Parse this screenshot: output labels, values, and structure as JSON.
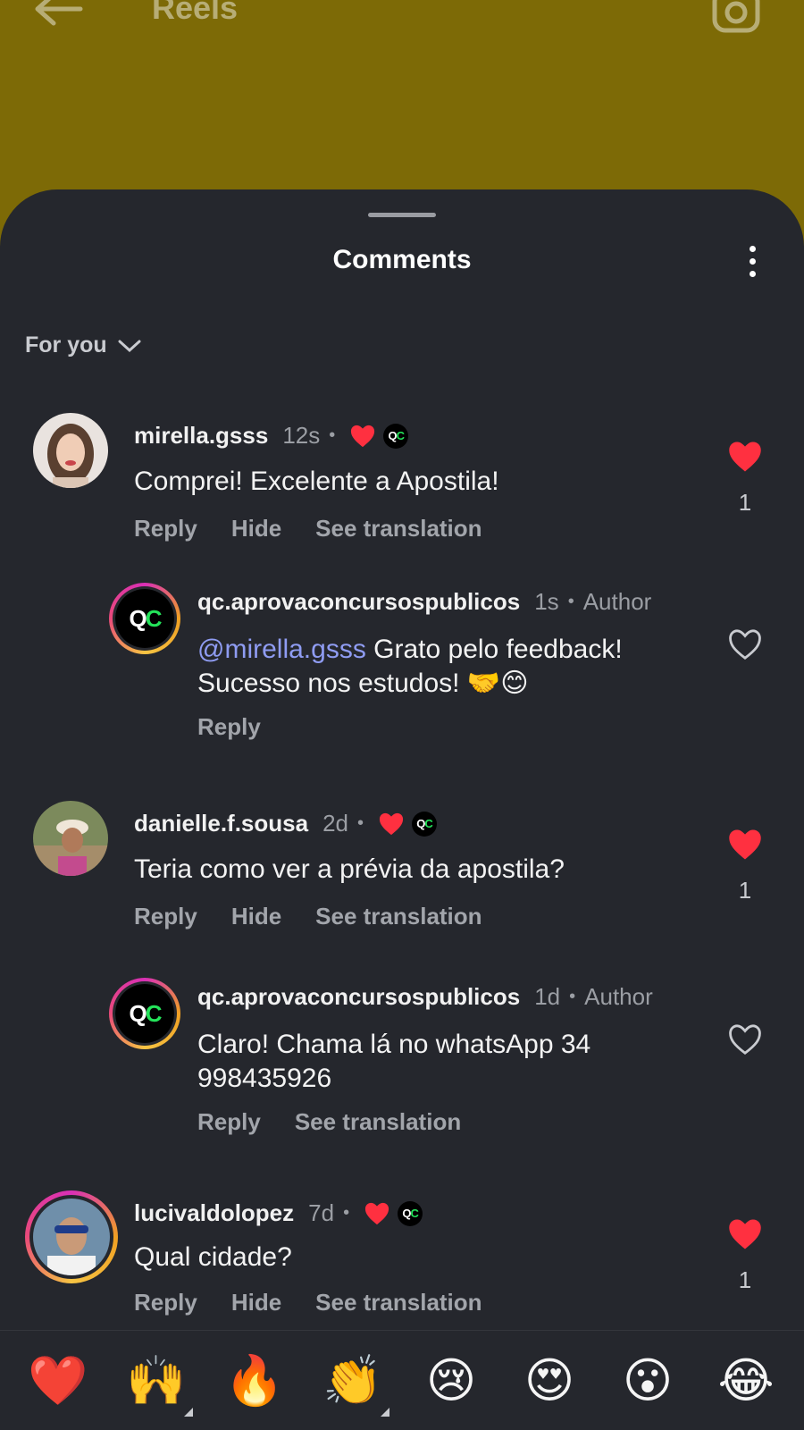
{
  "header": {
    "title": "Reels"
  },
  "sheet": {
    "title": "Comments",
    "filter_label": "For you"
  },
  "comments": [
    {
      "username": "mirella.gsss",
      "time": "12s",
      "text": "Comprei! Excelente a Apostila!",
      "actions": [
        "Reply",
        "Hide",
        "See translation"
      ],
      "likes": "1",
      "liked": true
    },
    {
      "username": "qc.aprovaconcursospublicos",
      "time": "1s",
      "badge": "Author",
      "mention": "@mirella.gsss",
      "text_line1": " Grato pelo feedback!",
      "text_line2": "Sucesso nos estudos! 🤝😊",
      "actions": [
        "Reply"
      ],
      "liked": false
    },
    {
      "username": "danielle.f.sousa",
      "time": "2d",
      "text": "Teria como ver a prévia da apostila?",
      "actions": [
        "Reply",
        "Hide",
        "See translation"
      ],
      "likes": "1",
      "liked": true
    },
    {
      "username": "qc.aprovaconcursospublicos",
      "time": "1d",
      "badge": "Author",
      "text_line1": "Claro! Chama lá no whatsApp 34",
      "text_line2": "998435926",
      "actions": [
        "Reply",
        "See translation"
      ],
      "liked": false
    },
    {
      "username": "lucivaldolopez",
      "time": "7d",
      "text": "Qual cidade?",
      "actions": [
        "Reply",
        "Hide",
        "See translation"
      ],
      "likes": "1",
      "liked": true
    }
  ],
  "logo": {
    "q": "Q",
    "c": "C"
  },
  "emoji_bar": [
    "❤️",
    "🙌",
    "🔥",
    "👏",
    "😢",
    "😍",
    "😮",
    "😂"
  ],
  "colors": {
    "background": "#7d6a06",
    "sheet": "#25272d",
    "like_red": "#ff3040",
    "mention": "#8f9cf2",
    "logo_green": "#24e35a"
  }
}
